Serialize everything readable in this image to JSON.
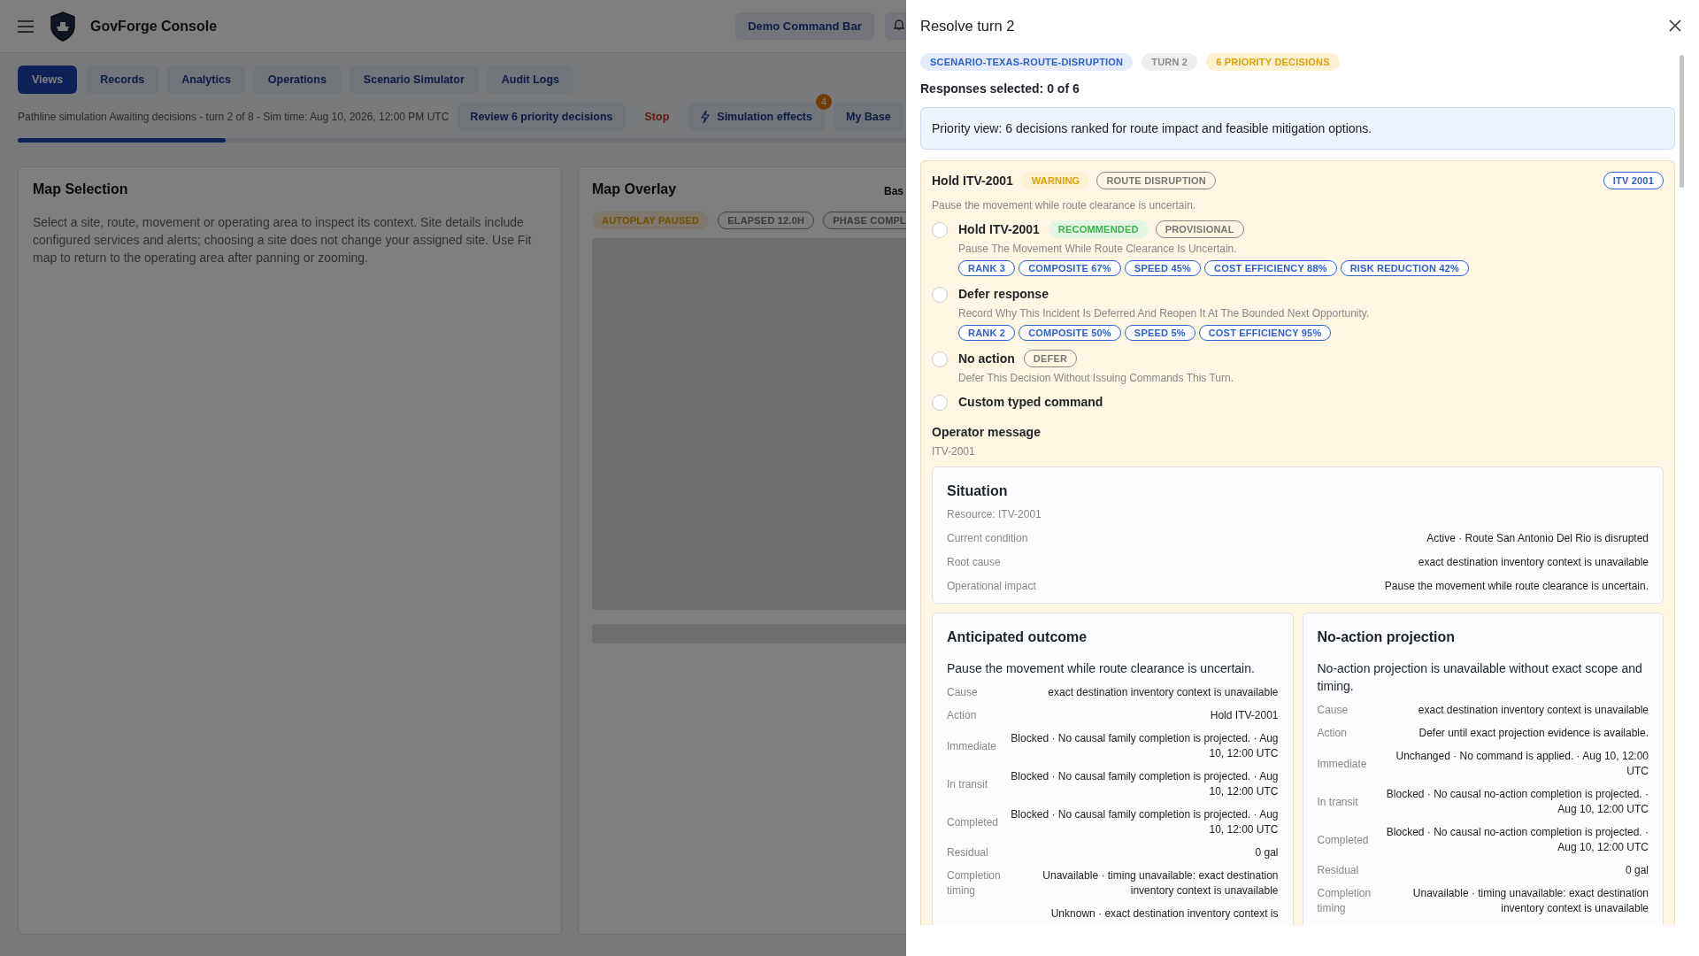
{
  "app": {
    "title": "GovForge Console",
    "command_bar": "Demo Command Bar"
  },
  "nav_tabs": [
    {
      "label": "Views",
      "selected": true
    },
    {
      "label": "Records",
      "selected": false
    },
    {
      "label": "Analytics",
      "selected": false
    },
    {
      "label": "Operations",
      "selected": false
    },
    {
      "label": "Scenario Simulator",
      "selected": false
    },
    {
      "label": "Audit Logs",
      "selected": false
    }
  ],
  "sim_bar": {
    "status": "Pathline simulation Awaiting decisions - turn 2 of 8 - Sim time: Aug 10, 2026, 12:00 PM UTC",
    "review_button": "Review 6 priority decisions",
    "stop_button": "Stop",
    "effects_button": "Simulation effects",
    "effects_badge": "4",
    "base_button": "My Base",
    "progress": {
      "level": 0.125
    }
  },
  "map_selection": {
    "title": "Map Selection",
    "text": "Select a site, route, movement or operating area to inspect its context. Site details include configured services and alerts; choosing a site does not change your assigned site. Use Fit map to return to the operating area after panning or zooming."
  },
  "map_overlay": {
    "title": "Map Overlay",
    "header_right": "Bas",
    "chips": [
      {
        "label": "AUTOPLAY PAUSED",
        "kind": "warning"
      },
      {
        "label": "ELAPSED 12.0H",
        "kind": "outline"
      },
      {
        "label": "PHASE COMPL",
        "kind": "outline"
      }
    ]
  },
  "drawer": {
    "title": "Resolve turn 2",
    "chips": [
      {
        "label": "SCENARIO-TEXAS-ROUTE-DISRUPTION",
        "kind": "info"
      },
      {
        "label": "TURN 2",
        "kind": "neutral"
      },
      {
        "label": "6 PRIORITY DECISIONS",
        "kind": "warning"
      }
    ],
    "responses_selected": "Responses selected: 0 of 6",
    "priority_note": "Priority view: 6 decisions ranked for route impact and feasible mitigation options.",
    "decision": {
      "title": "Hold ITV-2001",
      "chips": [
        {
          "label": "WARNING",
          "kind": "warning"
        },
        {
          "label": "ROUTE DISRUPTION",
          "kind": "outline"
        }
      ],
      "resource_tag": "ITV 2001",
      "description": "Pause the movement while route clearance is uncertain.",
      "options": [
        {
          "title": "Hold ITV-2001",
          "selected": false,
          "chips": [
            {
              "label": "RECOMMENDED",
              "kind": "success"
            },
            {
              "label": "PROVISIONAL",
              "kind": "outline"
            }
          ],
          "description": "Pause The Movement While Route Clearance Is Uncertain.",
          "metrics": [
            "RANK 3",
            "COMPOSITE 67%",
            "SPEED 45%",
            "COST EFFICIENCY 88%",
            "RISK REDUCTION 42%"
          ]
        },
        {
          "title": "Defer response",
          "selected": false,
          "description": "Record Why This Incident Is Deferred And Reopen It At The Bounded Next Opportunity.",
          "metrics": [
            "RANK 2",
            "COMPOSITE 50%",
            "SPEED 5%",
            "COST EFFICIENCY 95%"
          ]
        },
        {
          "title": "No action",
          "selected": false,
          "chips": [
            {
              "label": "DEFER",
              "kind": "outline"
            }
          ],
          "description": "Defer This Decision Without Issuing Commands This Turn."
        },
        {
          "title": "Custom typed command",
          "selected": false
        }
      ],
      "operator_label": "Operator message",
      "operator_value": "ITV-2001",
      "situation": {
        "title": "Situation",
        "subtitle": "Resource: ITV-2001",
        "rows": [
          {
            "label": "Current condition",
            "value": "Active · Route San Antonio Del Rio is disrupted"
          },
          {
            "label": "Root cause",
            "value": "exact destination inventory context is unavailable"
          },
          {
            "label": "Operational impact",
            "value": "Pause the movement while route clearance is uncertain."
          }
        ]
      },
      "outcomes": [
        {
          "title": "Anticipated outcome",
          "summary": "Pause the movement while route clearance is uncertain.",
          "rows": [
            {
              "label": "Cause",
              "value": "exact destination inventory context is unavailable"
            },
            {
              "label": "Action",
              "value": "Hold ITV-2001"
            },
            {
              "label": "Immediate",
              "value": "Blocked · No causal family completion is projected. · Aug 10, 12:00 UTC"
            },
            {
              "label": "In transit",
              "value": "Blocked · No causal family completion is projected. · Aug 10, 12:00 UTC"
            },
            {
              "label": "Completed",
              "value": "Blocked · No causal family completion is projected. · Aug 10, 12:00 UTC"
            },
            {
              "label": "Residual",
              "value": "0 gal"
            },
            {
              "label": "Completion timing",
              "value": "Unavailable · timing unavailable: exact destination inventory context is unavailable"
            },
            {
              "value": "Unknown · exact destination inventory context is"
            }
          ]
        },
        {
          "title": "No-action projection",
          "summary": "No-action projection is unavailable without exact scope and timing.",
          "rows": [
            {
              "label": "Cause",
              "value": "exact destination inventory context is unavailable"
            },
            {
              "label": "Action",
              "value": "Defer until exact projection evidence is available."
            },
            {
              "label": "Immediate",
              "value": "Unchanged · No command is applied. · Aug 10, 12:00 UTC"
            },
            {
              "label": "In transit",
              "value": "Blocked · No causal no-action completion is projected. · Aug 10, 12:00 UTC"
            },
            {
              "label": "Completed",
              "value": "Blocked · No causal no-action completion is projected. · Aug 10, 12:00 UTC"
            },
            {
              "label": "Residual",
              "value": "0 gal"
            },
            {
              "label": "Completion timing",
              "value": "Unavailable · timing unavailable: exact destination inventory context is unavailable"
            }
          ]
        }
      ]
    }
  }
}
